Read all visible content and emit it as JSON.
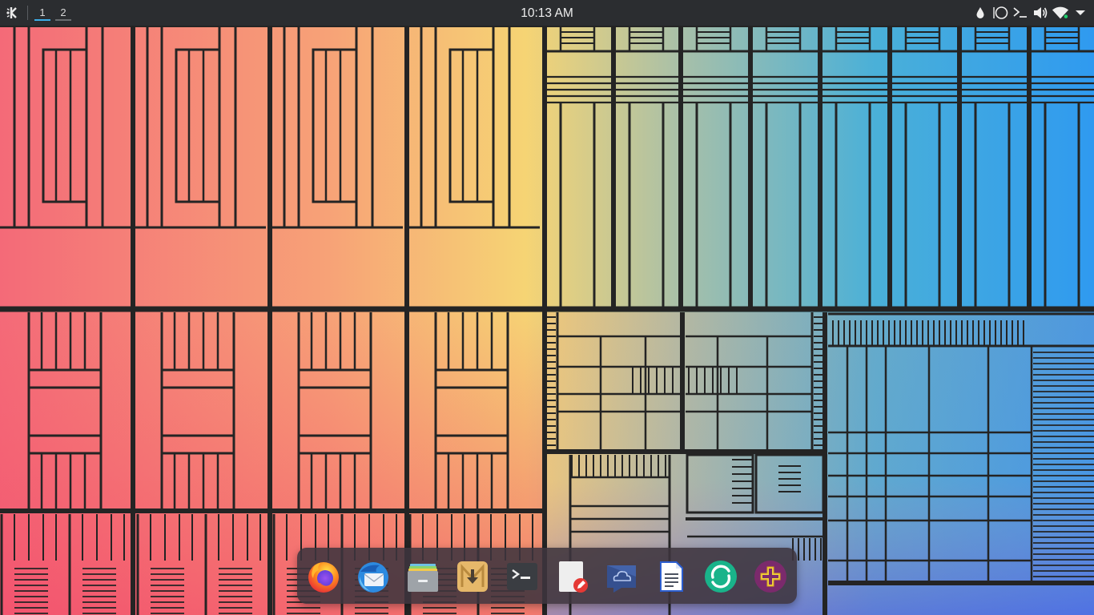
{
  "panel": {
    "app_menu_icon": "kde-logo-icon",
    "virtual_desktops": [
      {
        "label": "1",
        "active": true
      },
      {
        "label": "2",
        "active": false
      }
    ],
    "clock": "10:13 AM",
    "tray_icons": [
      "color-drop-icon",
      "circle-icon",
      "terminal-prompt-icon",
      "volume-icon",
      "wifi-icon",
      "chevron-down-icon"
    ]
  },
  "dock": {
    "items": [
      {
        "icon": "firefox-icon"
      },
      {
        "icon": "thunderbird-icon"
      },
      {
        "icon": "file-manager-icon"
      },
      {
        "icon": "downloader-icon"
      },
      {
        "icon": "terminal-icon"
      },
      {
        "icon": "note-editor-icon"
      },
      {
        "icon": "cloud-sync-icon"
      },
      {
        "icon": "document-writer-icon"
      },
      {
        "icon": "element-chat-icon"
      },
      {
        "icon": "add-app-icon"
      }
    ]
  },
  "colors": {
    "panel_bg": "#2b2d30",
    "accent": "#3daee9",
    "wallpaper_left": "#f04e6e",
    "wallpaper_mid": "#f5d06e",
    "wallpaper_right": "#3aa0ec",
    "wallpaper_bottom_right": "#5550d8"
  }
}
